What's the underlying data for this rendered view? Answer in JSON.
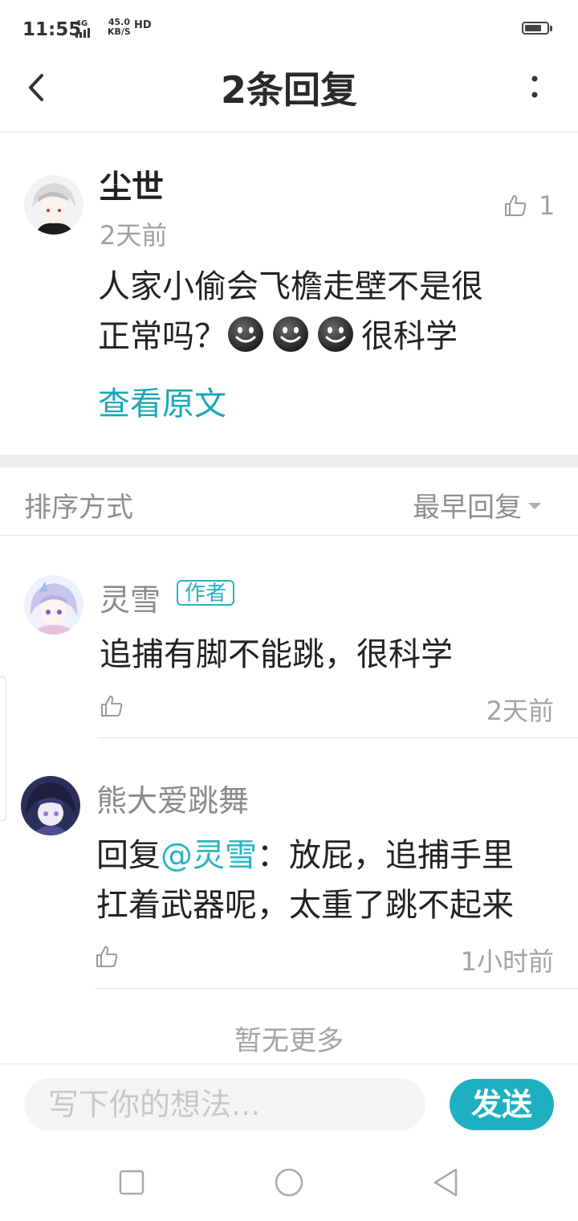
{
  "status_bar": {
    "time": "11:55",
    "network": "4G",
    "speed_value": "45.0",
    "speed_unit": "KB/S",
    "hd": "HD",
    "battery_level": 0.75
  },
  "header": {
    "title": "2条回复",
    "back_icon": "chevron-left-icon",
    "more_icon": "vertical-dots-icon"
  },
  "original_comment": {
    "username": "尘世",
    "time": "2天前",
    "text_line1": "人家小偷会飞檐走壁不是很",
    "text_line2_before": "正常吗？",
    "text_line2_after": "很科学",
    "emoji_count": 3,
    "emoji_icon": "dark-smiley-icon",
    "like_count": "1",
    "view_original": "查看原文"
  },
  "sort": {
    "label": "排序方式",
    "value": "最早回复"
  },
  "replies": [
    {
      "username": "灵雪",
      "badge": "作者",
      "text": "追捕有脚不能跳，很科学",
      "time": "2天前"
    },
    {
      "username": "熊大爱跳舞",
      "reply_prefix": "回复",
      "mention": "@灵雪",
      "text_line1_rest": "：放屁，追捕手里",
      "text_line2": "扛着武器呢，太重了跳不起来",
      "time": "1小时前"
    }
  ],
  "footer": {
    "no_more": "暂无更多",
    "input_placeholder": "写下你的想法...",
    "send_label": "发送"
  },
  "colors": {
    "accent": "#1eb0c0",
    "link": "#1aa7b8",
    "secondary_text": "#8e8e8e"
  }
}
